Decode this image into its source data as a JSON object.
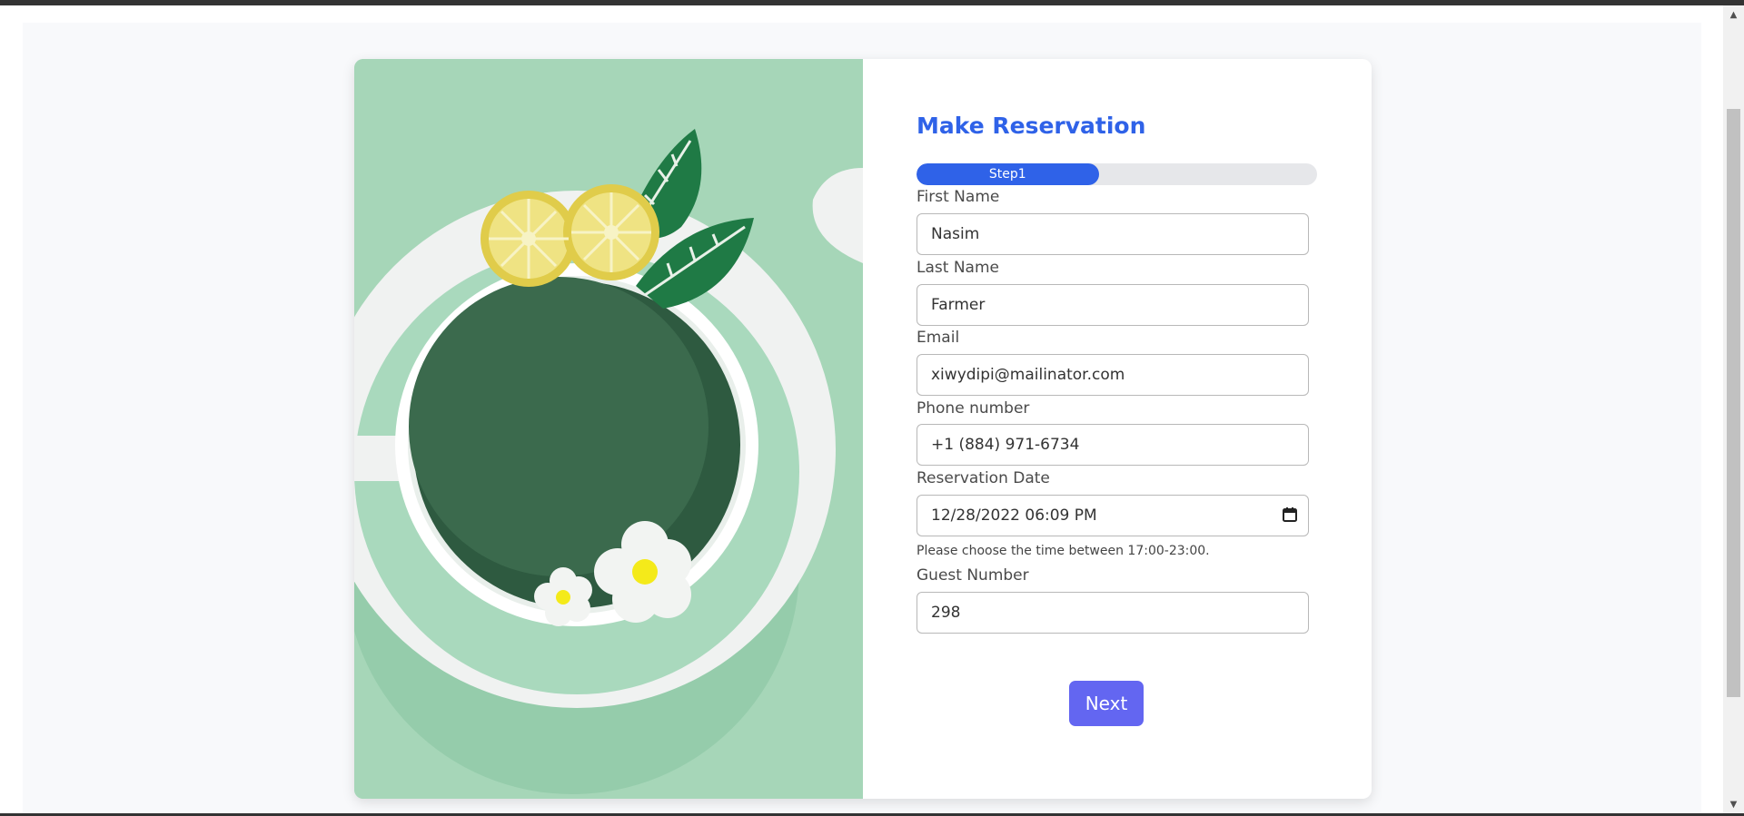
{
  "form": {
    "title": "Make Reservation",
    "progress": {
      "label": "Step1",
      "fraction": 0.455
    },
    "fields": {
      "first_name": {
        "label": "First Name",
        "value": "Nasim"
      },
      "last_name": {
        "label": "Last Name",
        "value": "Farmer"
      },
      "email": {
        "label": "Email",
        "value": "xiwydipi@mailinator.com"
      },
      "phone": {
        "label": "Phone number",
        "value": "+1 (884) 971-6734"
      },
      "reservation_date": {
        "label": "Reservation Date",
        "value": "12/28/2022 06:09 PM",
        "helper": "Please choose the time between 17:00-23:00."
      },
      "guest_number": {
        "label": "Guest Number",
        "value": "298"
      }
    },
    "next_label": "Next"
  },
  "colors": {
    "accent": "#2f62e8",
    "button": "#6366f1",
    "illustration_bg": "#a6d6b8"
  },
  "icons": {
    "calendar": "calendar-icon",
    "scroll_up": "scroll-up-arrow-icon",
    "scroll_down": "scroll-down-arrow-icon"
  }
}
